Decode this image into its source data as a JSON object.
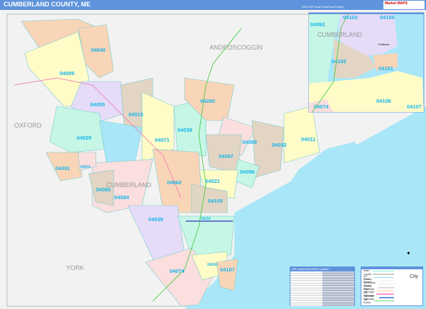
{
  "header": {
    "title": "CUMBERLAND COUNTY, ME",
    "edition": "2022 ZIP Code ColorCast Edition",
    "logo": "Market MAPS"
  },
  "counties": [
    "ANDROSCOGGIN",
    "OXFORD",
    "CUMBERLAND",
    "YORK"
  ],
  "zips": [
    "04040",
    "04009",
    "04055",
    "04015",
    "04029",
    "04071",
    "04039",
    "04260",
    "04069",
    "04097",
    "04032",
    "04011",
    "04096",
    "04021",
    "04062",
    "04105",
    "04084",
    "04085",
    "04091",
    "04024",
    "04038",
    "04074",
    "04107",
    "04106",
    "04110"
  ],
  "inset": {
    "county": "CUMBERLAND",
    "city": "Portland",
    "zips": [
      "04092",
      "04103",
      "04105",
      "04102",
      "04101",
      "04106",
      "04107",
      "04074"
    ]
  },
  "index_legend": {
    "title": "ZIP Code Index/Grid Location"
  },
  "map_legend": {
    "items": [
      "State",
      "County",
      "ZIP Code",
      "Primary Streets",
      "Secondary Streets",
      "County Highways",
      "State Highways",
      "US Highways",
      "Interstate Highways",
      "Toll Roads"
    ],
    "city_label": "City"
  },
  "colors": {
    "header": "#5f93dc",
    "water": "#a9e7f8",
    "land": "#f2f2f2",
    "zip_text": "#16b6ea"
  }
}
